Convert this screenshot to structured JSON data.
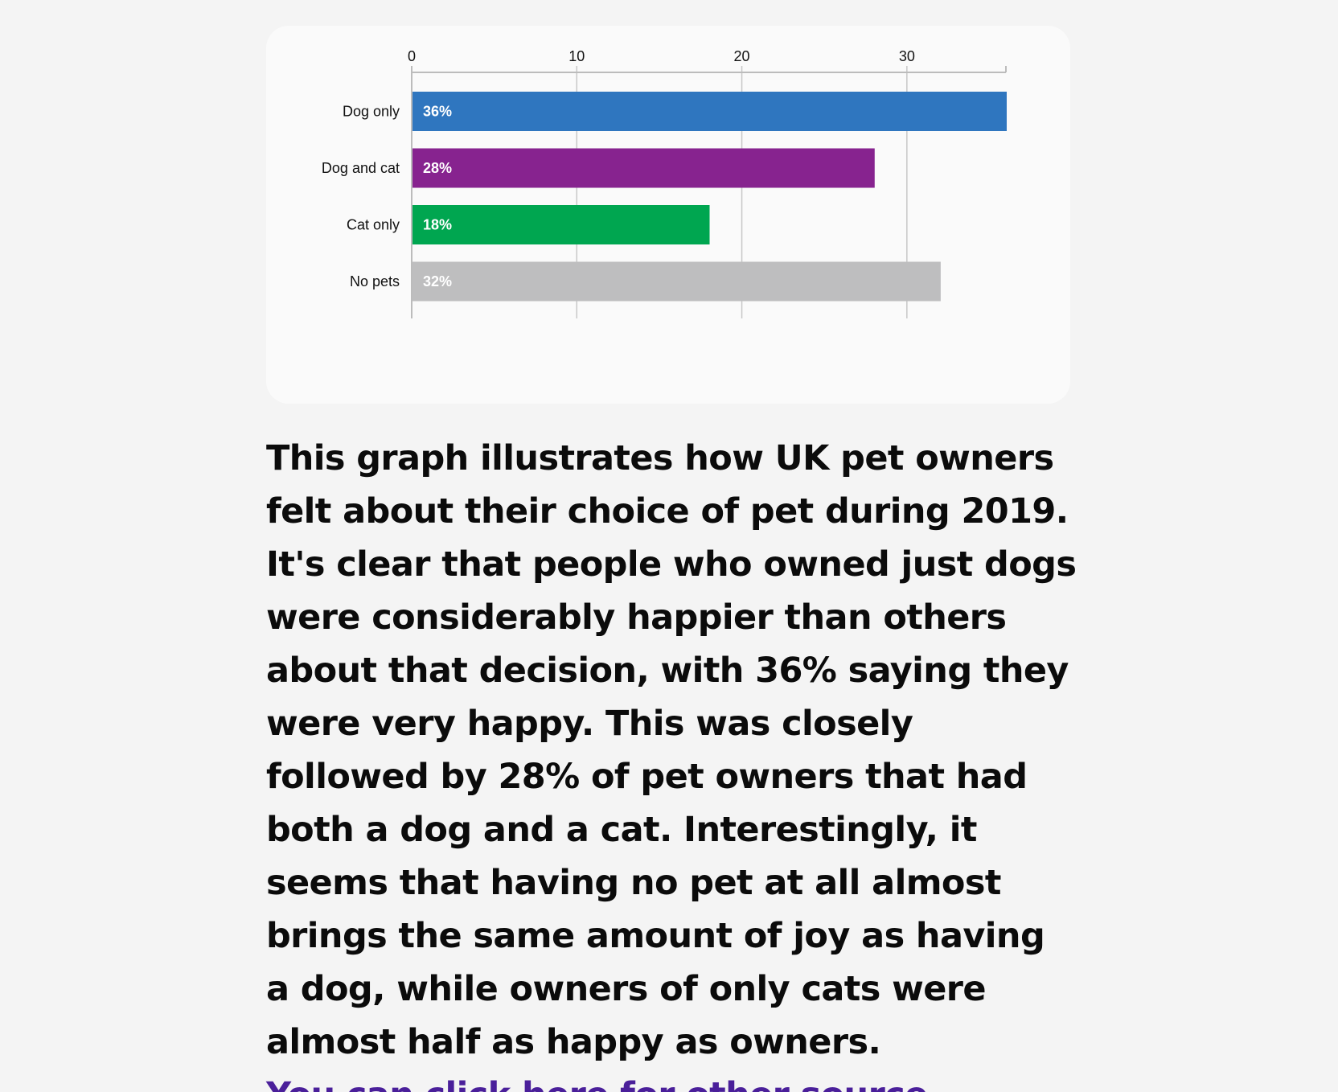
{
  "chart_data": {
    "type": "bar",
    "orientation": "horizontal",
    "categories": [
      "Dog only",
      "Dog and cat",
      "Cat only",
      "No pets"
    ],
    "values": [
      36,
      28,
      18,
      32
    ],
    "value_labels": [
      "36%",
      "28%",
      "18%",
      "32%"
    ],
    "bar_colors": [
      "#2f76bf",
      "#87238f",
      "#00a650",
      "#bebebf"
    ],
    "xticks": [
      0,
      10,
      20,
      30
    ],
    "xlim": [
      0,
      36
    ],
    "grid": true,
    "axis_position": "top"
  },
  "description": {
    "text": "This graph illustrates how UK pet owners felt about their choice of pet during 2019. It's clear that people who owned just dogs were considerably happier than others about that decision, with 36% saying they were very happy. This was closely followed by 28% of pet owners that had both a dog and a cat. Interestingly, it seems that having no pet at all almost brings the same amount of joy as having a dog, while owners of only cats were almost half as happy as owners.",
    "link_label": "You can click here for other source",
    "link_color": "#4a1f9a"
  }
}
